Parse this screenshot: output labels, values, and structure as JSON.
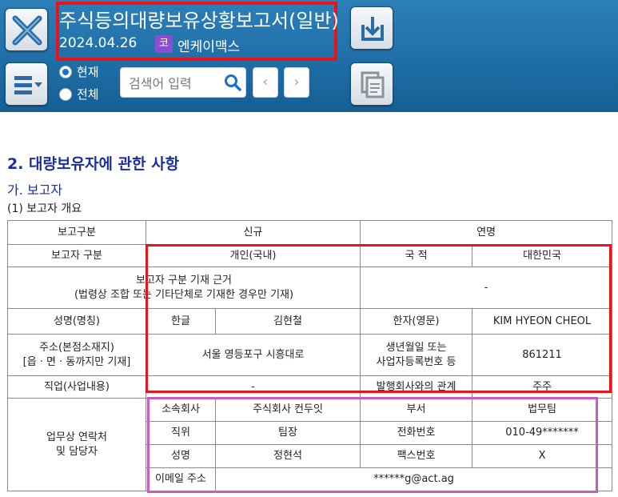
{
  "header": {
    "title": "주식등의대량보유상황보고서(일반)",
    "date": "2024.04.26",
    "market_badge": "코",
    "company": "엔케이맥스",
    "radio": {
      "current_label": "현재",
      "all_label": "전체",
      "selected": "현재"
    },
    "search": {
      "placeholder": "검색어 입력"
    },
    "prev_label": "‹",
    "next_label": "›"
  },
  "section": {
    "title": "2. 대량보유자에 관한 사항",
    "subtitle": "가. 보고자",
    "subsubtitle": "(1) 보고자 개요"
  },
  "table": {
    "r1": {
      "label": "보고구분",
      "new": "신규",
      "name_label": "연명"
    },
    "r2": {
      "label": "보고자 구분",
      "value": "개인(국내)",
      "nationality_label": "국 적",
      "nationality": "대한민국"
    },
    "r3": {
      "label_line1": "보고자 구분 기재 근거",
      "label_line2": "(법령상 조합 또는 기타단체로 기재한 경우만 기재)",
      "value": "-"
    },
    "r4": {
      "label": "성명(명칭)",
      "korean_label": "한글",
      "korean_name": "김현철",
      "hanja_label": "한자(영문)",
      "english_name": "KIM HYEON CHEOL"
    },
    "r5": {
      "label_line1": "주소(본점소재지)",
      "label_line2": "[읍 · 면 · 동까지만 기재]",
      "address": "서울 영등포구 시흥대로",
      "dob_label_line1": "생년월일 또는",
      "dob_label_line2": "사업자등록번호 등",
      "dob": "861211"
    },
    "r6": {
      "label": "직업(사업내용)",
      "value": "-",
      "relation_label": "발행회사와의 관계",
      "relation": "주주"
    },
    "contact": {
      "label_line1": "업무상 연락처",
      "label_line2": "및 담당자",
      "company_label": "소속회사",
      "company": "주식회사 컨두잇",
      "dept_label": "부서",
      "dept": "법무팀",
      "position_label": "직위",
      "position": "팀장",
      "phone_label": "전화번호",
      "phone": "010-49*******",
      "name_label": "성명",
      "name": "정현석",
      "fax_label": "팩스번호",
      "fax": "X",
      "email_label": "이메일 주소",
      "email": "******g@act.ag"
    }
  }
}
